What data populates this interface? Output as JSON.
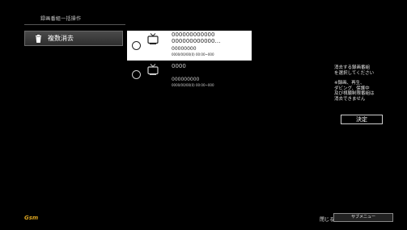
{
  "header": {
    "title": "録画番組一括操作"
  },
  "sidebar": {
    "items": [
      {
        "label": "複数消去",
        "icon": "trash-icon"
      }
    ]
  },
  "recordings": [
    {
      "selected": true,
      "title_line1": "000000000000",
      "title_line2": "000000000000…",
      "channel": "00000000",
      "datetime": "0000/00/00(0) 00:00~000"
    },
    {
      "selected": false,
      "title_line1": "0000",
      "title_line2": "",
      "channel": "000000000",
      "datetime": "0000/00/00(0) 00:00~000"
    }
  ],
  "help": {
    "line1": "消去する録画番組",
    "line2": "を選択してください",
    "note1": "※録画、再生、",
    "note2": "ダビング、保護中",
    "note3": "及び視聴制限番組は",
    "note4": "消去できません"
  },
  "actions": {
    "confirm_label": "決定",
    "close_label": "閉じる",
    "submenu_label": "サブメニュー"
  },
  "footer": {
    "logo_text": "Gsm"
  },
  "colors": {
    "selected_bg": "#ffffff",
    "background": "#000000",
    "logo": "#d9a320"
  }
}
